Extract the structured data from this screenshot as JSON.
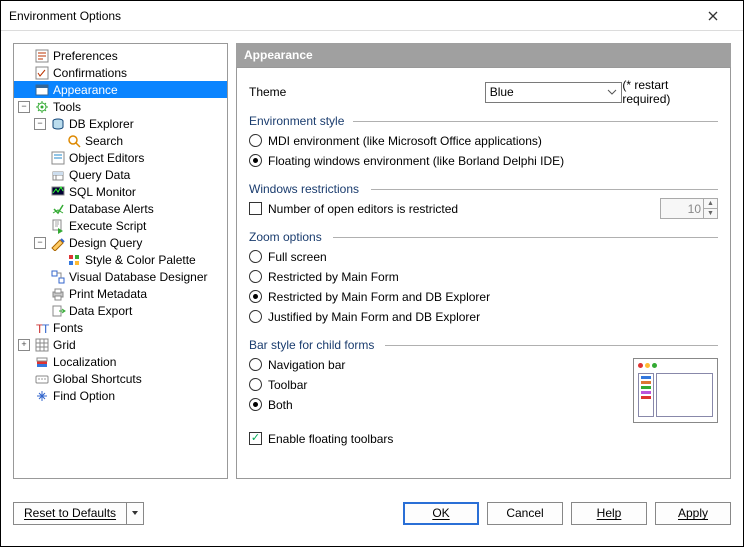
{
  "window": {
    "title": "Environment Options"
  },
  "tree": [
    {
      "lvl": 1,
      "exp": "",
      "icon": "prefs",
      "label": "Preferences"
    },
    {
      "lvl": 1,
      "exp": "",
      "icon": "confirm",
      "label": "Confirmations"
    },
    {
      "lvl": 1,
      "exp": "",
      "icon": "appear",
      "label": "Appearance",
      "selected": true
    },
    {
      "lvl": 1,
      "exp": "-",
      "icon": "tools",
      "label": "Tools"
    },
    {
      "lvl": 2,
      "exp": "-",
      "icon": "dbexp",
      "label": "DB Explorer"
    },
    {
      "lvl": 3,
      "exp": "",
      "icon": "search",
      "label": "Search"
    },
    {
      "lvl": 2,
      "exp": "",
      "icon": "objed",
      "label": "Object Editors"
    },
    {
      "lvl": 2,
      "exp": "",
      "icon": "query",
      "label": "Query Data"
    },
    {
      "lvl": 2,
      "exp": "",
      "icon": "sqlmon",
      "label": "SQL Monitor"
    },
    {
      "lvl": 2,
      "exp": "",
      "icon": "dbalert",
      "label": "Database Alerts"
    },
    {
      "lvl": 2,
      "exp": "",
      "icon": "exec",
      "label": "Execute Script"
    },
    {
      "lvl": 2,
      "exp": "-",
      "icon": "design",
      "label": "Design Query"
    },
    {
      "lvl": 3,
      "exp": "",
      "icon": "palette",
      "label": "Style & Color Palette"
    },
    {
      "lvl": 2,
      "exp": "",
      "icon": "vdd",
      "label": "Visual Database Designer"
    },
    {
      "lvl": 2,
      "exp": "",
      "icon": "print",
      "label": "Print Metadata"
    },
    {
      "lvl": 2,
      "exp": "",
      "icon": "export",
      "label": "Data Export"
    },
    {
      "lvl": 1,
      "exp": "",
      "icon": "fonts",
      "label": "Fonts"
    },
    {
      "lvl": 1,
      "exp": "+",
      "icon": "grid",
      "label": "Grid"
    },
    {
      "lvl": 1,
      "exp": "",
      "icon": "local",
      "label": "Localization"
    },
    {
      "lvl": 1,
      "exp": "",
      "icon": "short",
      "label": "Global Shortcuts"
    },
    {
      "lvl": 1,
      "exp": "",
      "icon": "find",
      "label": "Find Option"
    }
  ],
  "header": "Appearance",
  "theme": {
    "label": "Theme",
    "value": "Blue",
    "note": "(* restart required)"
  },
  "groups": {
    "env_style": {
      "title": "Environment style",
      "tw": 104,
      "options": [
        {
          "label": "MDI environment (like Microsoft Office applications)",
          "checked": false
        },
        {
          "label": "Floating windows environment (like Borland Delphi IDE)",
          "checked": true
        }
      ]
    },
    "win_restrict": {
      "title": "Windows restrictions",
      "tw": 122,
      "check_label": "Number of open editors is restricted",
      "check_checked": false,
      "num_value": "10"
    },
    "zoom": {
      "title": "Zoom options",
      "tw": 84,
      "options": [
        {
          "label": "Full screen",
          "checked": false
        },
        {
          "label": "Restricted by Main Form",
          "checked": false
        },
        {
          "label": "Restricted by Main Form and DB Explorer",
          "checked": true
        },
        {
          "label": "Justified by Main Form and DB Explorer",
          "checked": false
        }
      ]
    },
    "bar": {
      "title": "Bar style for child forms",
      "tw": 136,
      "options": [
        {
          "label": "Navigation bar",
          "checked": false
        },
        {
          "label": "Toolbar",
          "checked": false
        },
        {
          "label": "Both",
          "checked": true
        }
      ],
      "floating_label": "Enable floating toolbars",
      "floating_checked": true
    }
  },
  "footer": {
    "reset": "Reset to Defaults",
    "ok": "OK",
    "cancel": "Cancel",
    "help": "Help",
    "apply": "Apply"
  }
}
